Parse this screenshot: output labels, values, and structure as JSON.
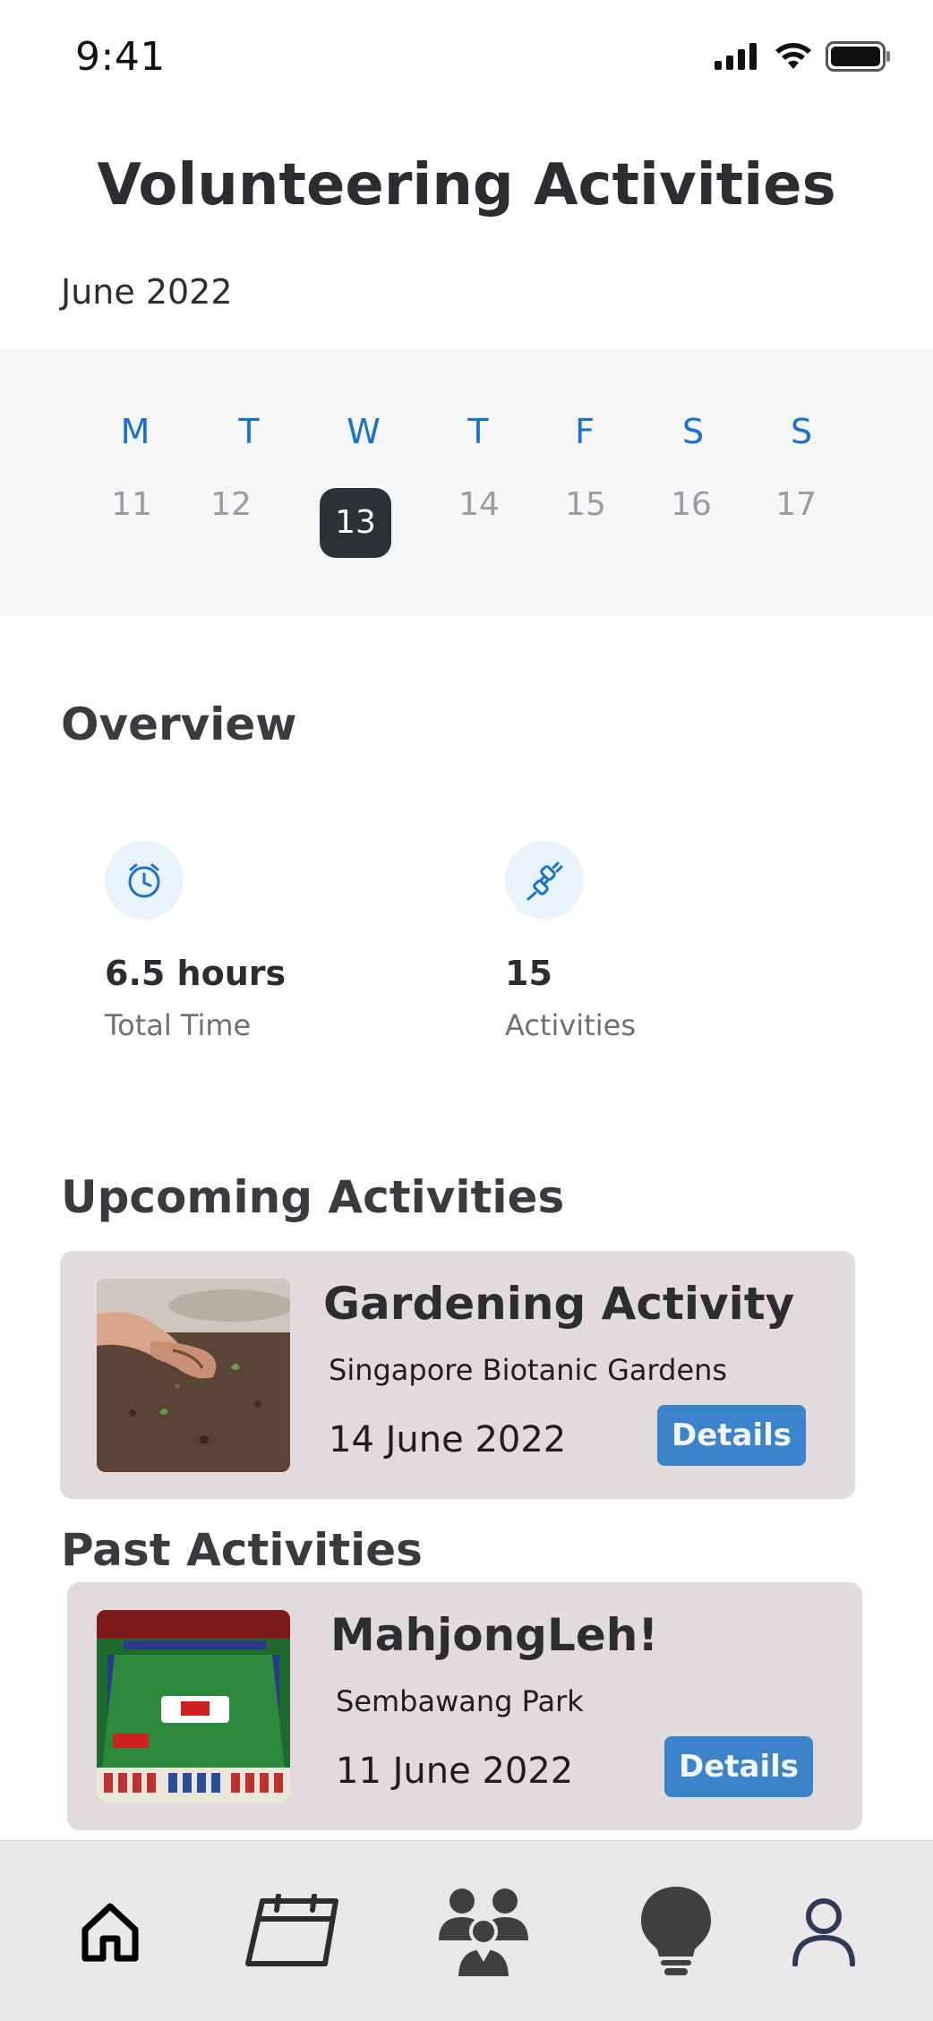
{
  "status_bar": {
    "time": "9:41"
  },
  "header": {
    "title": "Volunteering Activities",
    "month": "June 2022"
  },
  "week": {
    "days": [
      {
        "name": "M",
        "date": "11"
      },
      {
        "name": "T",
        "date": "12"
      },
      {
        "name": "W",
        "date": "13"
      },
      {
        "name": "T",
        "date": "14"
      },
      {
        "name": "F",
        "date": "15"
      },
      {
        "name": "S",
        "date": "16"
      },
      {
        "name": "S",
        "date": "17"
      }
    ],
    "selected_date": "13"
  },
  "overview": {
    "title": "Overview",
    "stats": [
      {
        "icon": "clock-icon",
        "value": "6.5 hours",
        "label": "Total Time"
      },
      {
        "icon": "activity-plug-icon",
        "value": "15",
        "label": "Activities"
      }
    ]
  },
  "upcoming": {
    "title": "Upcoming Activities",
    "item": {
      "title": "Gardening Activity",
      "location": "Singapore Biotanic Gardens",
      "date": "14 June 2022",
      "button": "Details",
      "image": "gardening-photo"
    }
  },
  "past": {
    "title": "Past Activities",
    "item": {
      "title": "MahjongLeh!",
      "location": "Sembawang Park",
      "date": "11 June 2022",
      "button": "Details",
      "image": "mahjong-game-screenshot"
    }
  },
  "bottom_nav": {
    "items": [
      {
        "icon": "home-icon",
        "active": true
      },
      {
        "icon": "calendar-icon",
        "active": false
      },
      {
        "icon": "community-icon",
        "active": false
      },
      {
        "icon": "lightbulb-icon",
        "active": false
      },
      {
        "icon": "profile-icon",
        "active": false
      }
    ]
  },
  "colors": {
    "accent_blue": "#1a6fd4",
    "button_blue": "#3b84cc",
    "card_bg": "#e1dbdb",
    "selected_day": "#2c3136"
  }
}
